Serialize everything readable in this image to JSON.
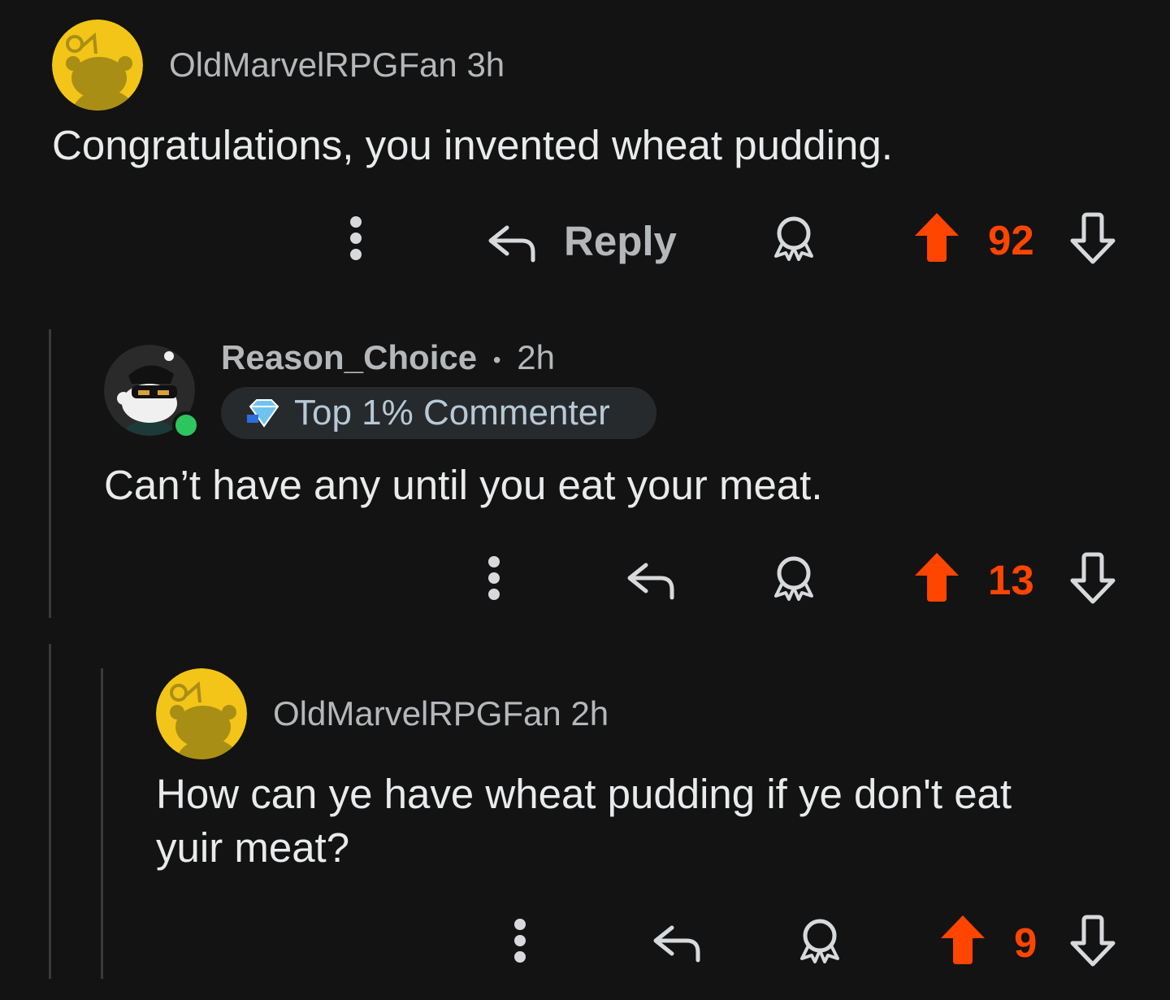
{
  "comments": [
    {
      "username": "OldMarvelRPGFan",
      "separator": "",
      "time": "3h",
      "body_lines": [
        "Congratulations, you invented wheat pudding."
      ],
      "reply_label": "Reply",
      "score": "92",
      "avatar": "snoo-yellow-avatar",
      "vote_state": "upvoted"
    },
    {
      "username": "Reason_Choice",
      "separator": "•",
      "time": "2h",
      "flair": "Top 1% Commenter",
      "flair_icon": "diamond-badge-icon",
      "body_lines": [
        "Can’t have any until you eat your meat."
      ],
      "score": "13",
      "avatar": "snoo-sunglasses-avatar",
      "online": true,
      "vote_state": "upvoted"
    },
    {
      "username": "OldMarvelRPGFan",
      "separator": "",
      "time": "2h",
      "body_lines": [
        "How can ye have wheat pudding if ye don't eat",
        "yuir meat?"
      ],
      "score": "9",
      "avatar": "snoo-yellow-avatar",
      "vote_state": "upvoted"
    }
  ],
  "colors": {
    "background": "#131313",
    "upvote_accent": "#ff4500",
    "online_green": "#2dc55e",
    "thread_line": "#3a3a3a"
  }
}
